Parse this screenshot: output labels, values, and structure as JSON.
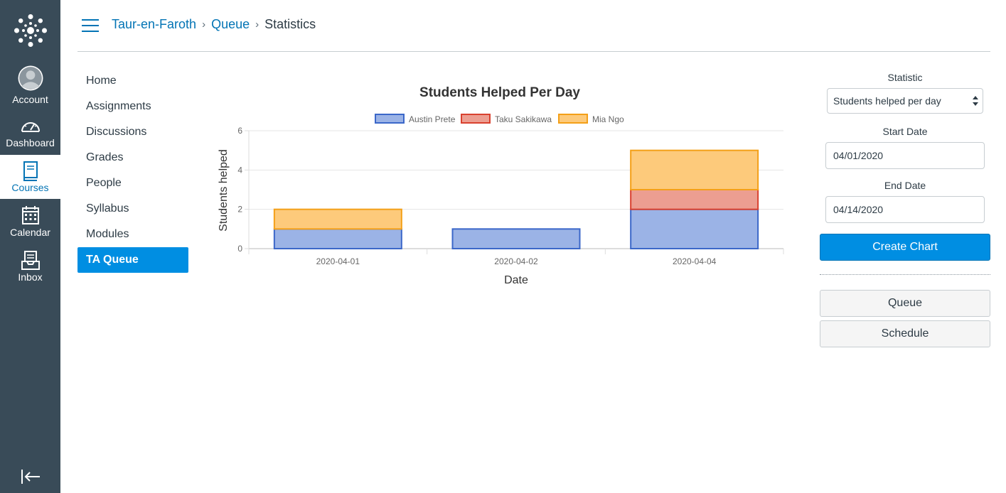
{
  "global_nav": {
    "account": "Account",
    "dashboard": "Dashboard",
    "courses": "Courses",
    "calendar": "Calendar",
    "inbox": "Inbox"
  },
  "breadcrumb": {
    "course": "Taur-en-Faroth",
    "queue": "Queue",
    "current": "Statistics"
  },
  "course_nav": {
    "items": [
      "Home",
      "Assignments",
      "Discussions",
      "Grades",
      "People",
      "Syllabus",
      "Modules",
      "TA Queue"
    ],
    "active_index": 7
  },
  "right_panel": {
    "statistic_label": "Statistic",
    "statistic_value": "Students helped per day",
    "start_label": "Start Date",
    "start_value": "04/01/2020",
    "end_label": "End Date",
    "end_value": "04/14/2020",
    "create_button": "Create Chart",
    "queue_button": "Queue",
    "schedule_button": "Schedule"
  },
  "colors": {
    "nav_bg": "#394b58",
    "accent": "#008ee2",
    "link": "#0374b5"
  },
  "chart_data": {
    "type": "bar",
    "stacked": true,
    "title": "Students Helped Per Day",
    "xlabel": "Date",
    "ylabel": "Students helped",
    "categories": [
      "2020-04-01",
      "2020-04-02",
      "2020-04-04"
    ],
    "series": [
      {
        "name": "Austin Prete",
        "values": [
          1,
          1,
          2
        ],
        "fill": "#9bb3e6",
        "stroke": "#3b67c9"
      },
      {
        "name": "Taku Sakikawa",
        "values": [
          0,
          0,
          1
        ],
        "fill": "#ec9e91",
        "stroke": "#d9412f"
      },
      {
        "name": "Mia Ngo",
        "values": [
          1,
          0,
          2
        ],
        "fill": "#fdca7b",
        "stroke": "#f4a018"
      }
    ],
    "ylim": [
      0,
      6
    ],
    "yticks": [
      0,
      2,
      4,
      6
    ],
    "grid": true,
    "legend": "top"
  }
}
